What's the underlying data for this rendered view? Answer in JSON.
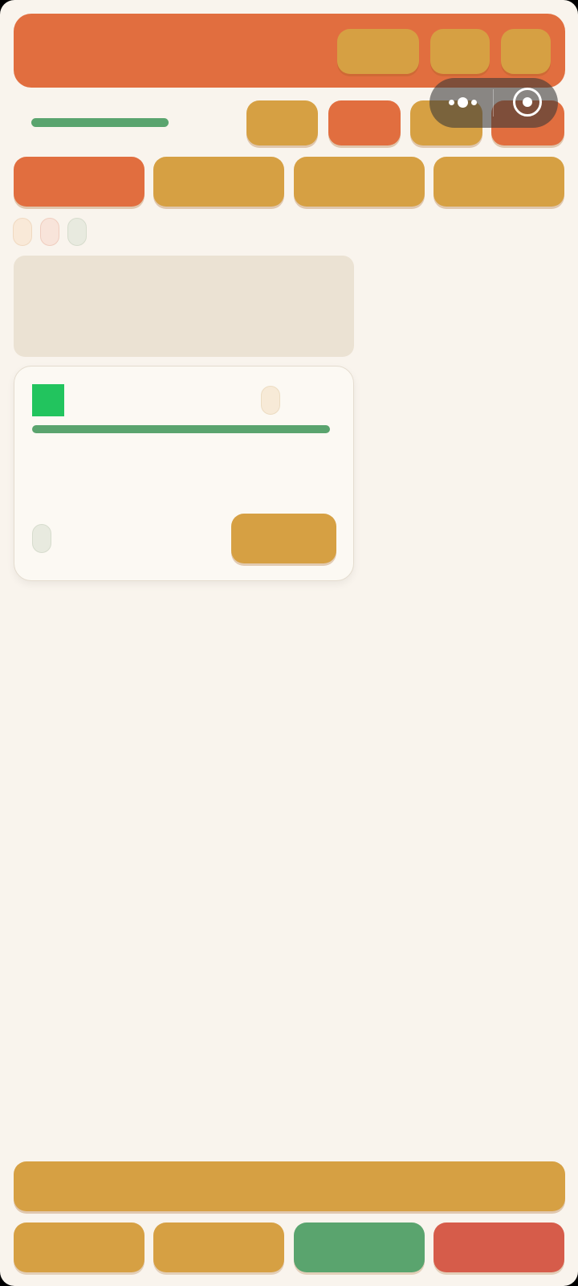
{
  "colors": {
    "screen_bg": "#f9f4ed",
    "header_bg": "#e16e3f",
    "button_gold": "#d6a043",
    "button_orange": "#e16e3f",
    "accent_green": "#5aa46e",
    "square_green": "#22c45e",
    "danger_red": "#d65c4a",
    "placeholder": "#ebe2d3",
    "card_bg": "#fcf9f3"
  },
  "capsule": {
    "menu_icon": "more-dots-icon",
    "close_icon": "target-circle-icon"
  },
  "header": {
    "buttons": [
      "",
      "",
      ""
    ]
  },
  "toolbar": {
    "title": "",
    "buttons": [
      "",
      "",
      "",
      ""
    ]
  },
  "tabs": [
    "",
    "",
    "",
    ""
  ],
  "chips": [
    "",
    "",
    ""
  ],
  "card": {
    "title": "",
    "badge": "",
    "chip": "",
    "action_label": ""
  },
  "footer": {
    "primary_label": "",
    "buttons": [
      "",
      "",
      "",
      ""
    ]
  }
}
